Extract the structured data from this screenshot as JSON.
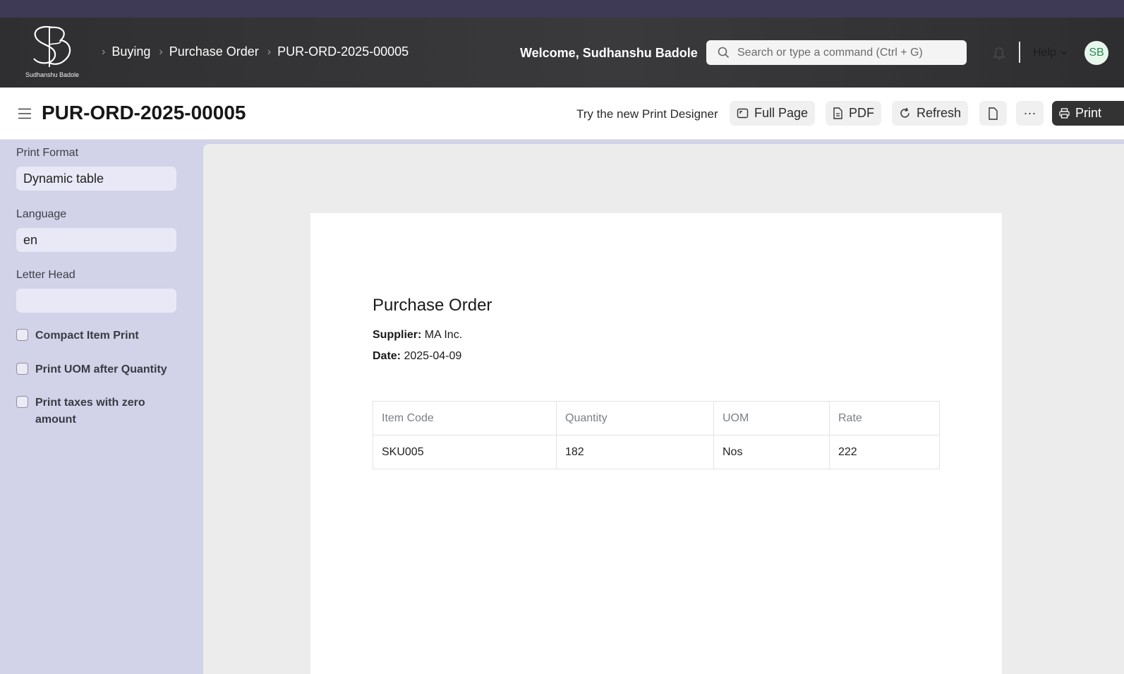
{
  "brand": {
    "name": "Sudhanshu Badole"
  },
  "breadcrumbs": [
    "Buying",
    "Purchase Order",
    "PUR-ORD-2025-00005"
  ],
  "navbar": {
    "welcome": "Welcome, Sudhanshu Badole",
    "search_placeholder": "Search or type a command (Ctrl + G)",
    "help_label": "Help",
    "avatar_initials": "SB"
  },
  "page": {
    "title": "PUR-ORD-2025-00005",
    "designer_link": "Try the new Print Designer",
    "buttons": {
      "full_page": "Full Page",
      "pdf": "PDF",
      "refresh": "Refresh",
      "more": "···",
      "print": "Print"
    }
  },
  "sidebar": {
    "print_format": {
      "label": "Print Format",
      "value": "Dynamic table"
    },
    "language": {
      "label": "Language",
      "value": "en"
    },
    "letter_head": {
      "label": "Letter Head",
      "value": ""
    },
    "checkboxes": [
      {
        "label": "Compact Item Print",
        "checked": false
      },
      {
        "label": "Print UOM after Quantity",
        "checked": false
      },
      {
        "label": "Print taxes with zero amount",
        "checked": false
      }
    ]
  },
  "document": {
    "title": "Purchase Order",
    "supplier_label": "Supplier:",
    "supplier_value": "MA Inc.",
    "date_label": "Date:",
    "date_value": "2025-04-09",
    "table": {
      "headers": [
        "Item Code",
        "Quantity",
        "UOM",
        "Rate"
      ],
      "rows": [
        [
          "SKU005",
          "182",
          "Nos",
          "222"
        ]
      ]
    }
  },
  "colors": {
    "navbar": "#333335",
    "sidebar": "#d2d3e8",
    "print_button": "#333333",
    "avatar_bg": "#e7f7ec",
    "avatar_text": "#2f8a56"
  }
}
